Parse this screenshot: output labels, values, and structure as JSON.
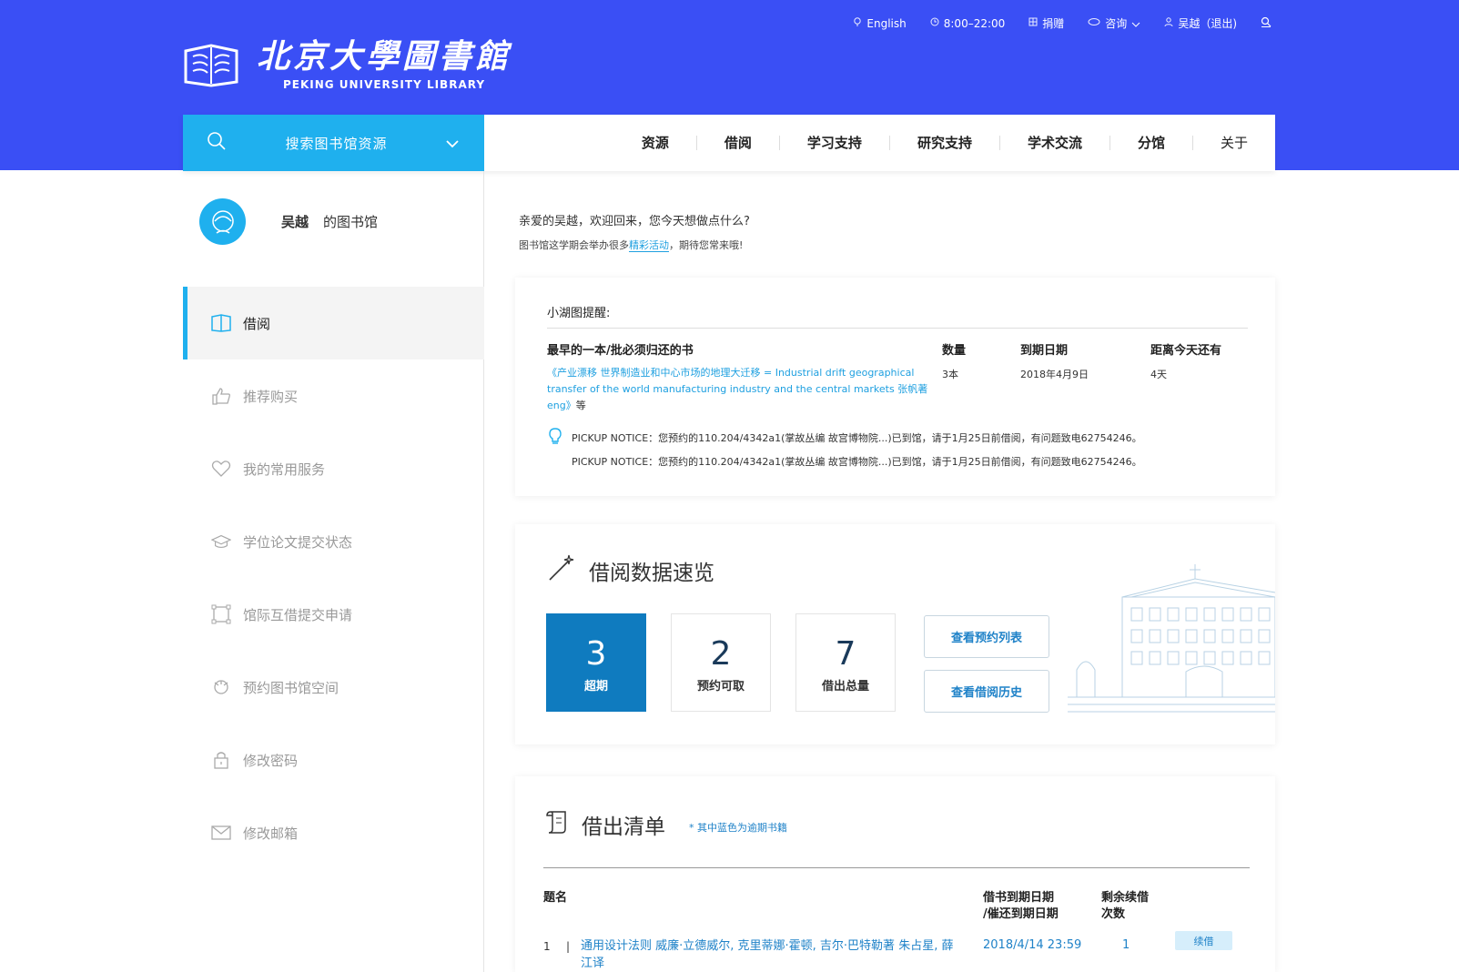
{
  "topbar": {
    "language": "English",
    "hours": "8:00–22:00",
    "donate": "捐赠",
    "consult": "咨询",
    "user": "吴越（退出)"
  },
  "logo": {
    "cn": "北京大學圖書館",
    "en": "PEKING UNIVERSITY LIBRARY"
  },
  "search": {
    "label": "搜索图书馆资源"
  },
  "nav": {
    "items": [
      "资源",
      "借阅",
      "学习支持",
      "研究支持",
      "学术交流",
      "分馆",
      "关于"
    ]
  },
  "profile": {
    "name": "吴越",
    "suffix": "的图书馆"
  },
  "sidebar": {
    "items": [
      {
        "label": "借阅",
        "icon": "book-icon",
        "active": true
      },
      {
        "label": "推荐购买",
        "icon": "thumbs-up-icon"
      },
      {
        "label": "我的常用服务",
        "icon": "heart-icon"
      },
      {
        "label": "学位论文提交状态",
        "icon": "graduation-cap-icon"
      },
      {
        "label": "馆际互借提交申请",
        "icon": "frame-icon"
      },
      {
        "label": "预约图书馆空间",
        "icon": "space-icon"
      },
      {
        "label": "修改密码",
        "icon": "lock-icon"
      },
      {
        "label": "修改邮箱",
        "icon": "mail-icon"
      }
    ]
  },
  "welcome": {
    "line1": "亲爱的吴越，欢迎回来，您今天想做点什么?",
    "line2_prefix": "图书馆这学期会举办很多",
    "line2_link": "精彩活动",
    "line2_suffix": "，期待您常来哦!"
  },
  "reminder": {
    "title": "小湖图提醒:",
    "col_book": "最早的一本/批必须归还的书",
    "col_qty": "数量",
    "col_due": "到期日期",
    "col_remaining": "距离今天还有",
    "book_title": "《产业漂移 世界制造业和中心市场的地理大迁移 = Industrial drift geographical transfer of the world manufacturing industry and the central markets 张帆著 eng》",
    "book_tail": "等",
    "qty": "3本",
    "due": "2018年4月9日",
    "remaining": "4天",
    "notices": [
      "PICKUP NOTICE：您预约的110.204/4342a1(掌故丛编 故宫博物院...)已到馆，请于1月25日前借阅，有问题致电62754246。",
      "PICKUP NOTICE：您预约的110.204/4342a1(掌故丛编 故宫博物院...)已到馆，请于1月25日前借阅，有问题致电62754246。"
    ]
  },
  "overview": {
    "title": "借阅数据速览",
    "stats": [
      {
        "value": "3",
        "label": "超期"
      },
      {
        "value": "2",
        "label": "预约可取"
      },
      {
        "value": "7",
        "label": "借出总量"
      }
    ],
    "btn_reservations": "查看预约列表",
    "btn_history": "查看借阅历史"
  },
  "loans": {
    "title": "借出清单",
    "note": "* 其中蓝色为逾期书籍",
    "col_title": "题名",
    "col_due_1": "借书到期日期",
    "col_due_2": "/催还到期日期",
    "col_renew_1": "剩余续借",
    "col_renew_2": "次数",
    "rows": [
      {
        "num": "1",
        "title": "通用设计法则 威廉·立德威尔, 克里蒂娜·霍顿, 吉尔·巴特勒著 朱占星, 薛江译",
        "due": "2018/4/14 23:59",
        "renewals": "1",
        "action": "续借"
      }
    ]
  },
  "colors": {
    "header_blue": "#3a4ff5",
    "accent_cyan": "#1fb0ee",
    "stat_primary": "#0f7bbf",
    "link_blue": "#1f82c8"
  }
}
